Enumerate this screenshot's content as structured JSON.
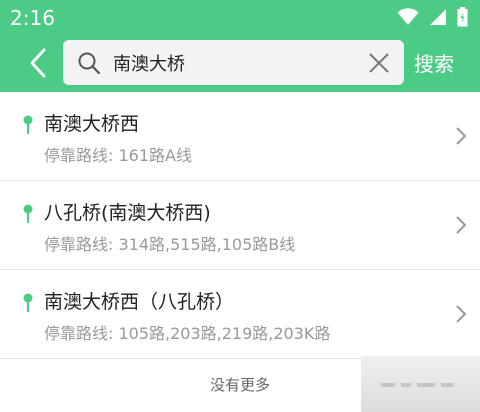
{
  "status_bar": {
    "time": "2:16",
    "icons": [
      "wifi-icon",
      "signal-icon",
      "battery-icon"
    ]
  },
  "toolbar": {
    "back_icon": "chevron-left-icon",
    "search": {
      "value": "南澳大桥",
      "placeholder": ""
    },
    "search_button_label": "搜索"
  },
  "results": [
    {
      "name": "南澳大桥西",
      "routes": "停靠路线: 161路A线"
    },
    {
      "name": "八孔桥(南澳大桥西)",
      "routes": "停靠路线: 314路,515路,105路B线"
    },
    {
      "name": "南澳大桥西（八孔桥）",
      "routes": "停靠路线: 105路,203路,219路,203K路"
    }
  ],
  "footer_text": "没有更多",
  "colors": {
    "accent": "#4ccb86",
    "pin": "#4ccb86",
    "secondary_text": "#999999"
  }
}
